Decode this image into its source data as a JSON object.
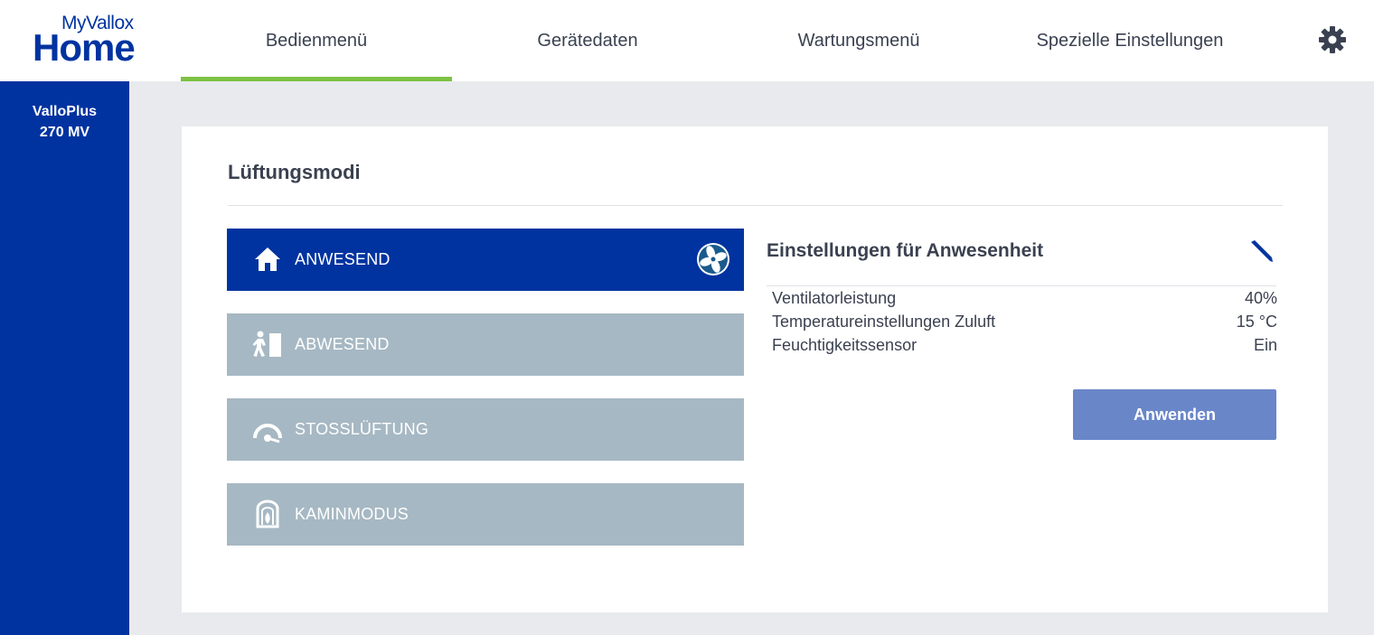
{
  "logo": {
    "small": "MyVallox",
    "big": "Home"
  },
  "nav": {
    "tabs": [
      {
        "label": "Bedienmenü",
        "active": true
      },
      {
        "label": "Gerätedaten",
        "active": false
      },
      {
        "label": "Wartungsmenü",
        "active": false
      },
      {
        "label": "Spezielle Einstellungen",
        "active": false
      }
    ],
    "settings_icon": "gear-icon"
  },
  "sidebar": {
    "device_line1": "ValloPlus",
    "device_line2": "270 MV"
  },
  "main": {
    "title": "Lüftungsmodi",
    "modes": [
      {
        "label": "ANWESEND",
        "icon": "home-icon",
        "active": true,
        "badge_icon": "fan-icon"
      },
      {
        "label": "ABWESEND",
        "icon": "leaving-icon",
        "active": false
      },
      {
        "label": "STOSSLÜFTUNG",
        "icon": "boost-gauge-icon",
        "active": false
      },
      {
        "label": "KAMINMODUS",
        "icon": "fireplace-icon",
        "active": false
      }
    ],
    "settings": {
      "title": "Einstellungen für Anwesenheit",
      "edit_icon": "pencil-icon",
      "rows": [
        {
          "label": "Ventilatorleistung",
          "value": "40%"
        },
        {
          "label": "Temperatureinstellungen Zuluft",
          "value": "15 °C"
        },
        {
          "label": "Feuchtigkeitssensor",
          "value": "Ein"
        }
      ],
      "apply_label": "Anwenden"
    }
  },
  "colors": {
    "brand": "#0033a0",
    "accent": "#7dc242",
    "inactive_mode": "#a6b8c3",
    "button": "#6986c9",
    "background": "#e8eaed"
  }
}
